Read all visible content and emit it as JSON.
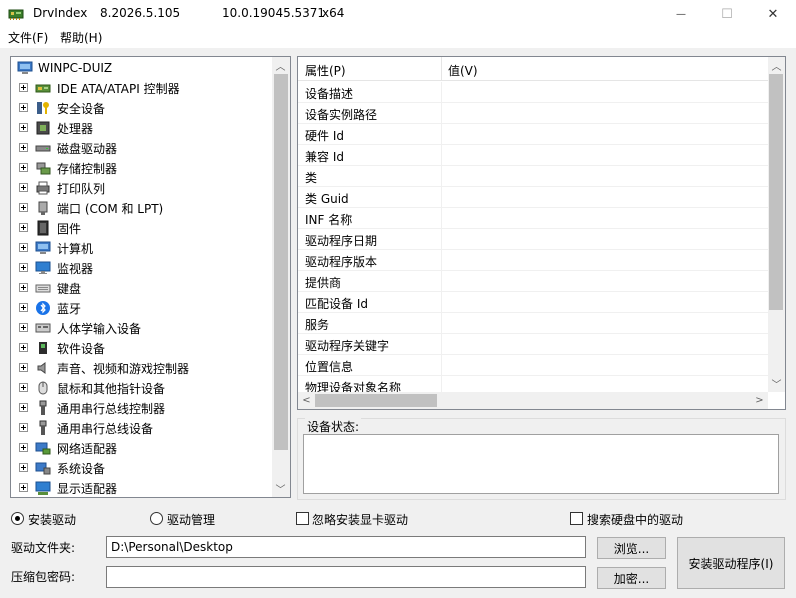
{
  "window": {
    "app_name": "DrvIndex",
    "version": "8.2026.5.105",
    "os_build": "10.0.19045.5371",
    "arch": "x64",
    "minimize_glyph": "—",
    "maximize_glyph": "☐",
    "close_glyph": "✕"
  },
  "menu": {
    "file": "文件(F)",
    "help": "帮助(H)"
  },
  "tree": {
    "root": {
      "label": "WINPC-DUIZ",
      "icon": "computer-icon"
    },
    "items": [
      {
        "label": "IDE ATA/ATAPI 控制器",
        "icon": "ide-controller-icon"
      },
      {
        "label": "安全设备",
        "icon": "security-key-icon"
      },
      {
        "label": "处理器",
        "icon": "cpu-icon"
      },
      {
        "label": "磁盘驱动器",
        "icon": "disk-drive-icon"
      },
      {
        "label": "存储控制器",
        "icon": "storage-controller-icon"
      },
      {
        "label": "打印队列",
        "icon": "printer-icon"
      },
      {
        "label": "端口 (COM 和 LPT)",
        "icon": "port-icon"
      },
      {
        "label": "固件",
        "icon": "firmware-icon"
      },
      {
        "label": "计算机",
        "icon": "computer-icon"
      },
      {
        "label": "监视器",
        "icon": "monitor-icon"
      },
      {
        "label": "键盘",
        "icon": "keyboard-icon"
      },
      {
        "label": "蓝牙",
        "icon": "bluetooth-icon"
      },
      {
        "label": "人体学输入设备",
        "icon": "hid-icon"
      },
      {
        "label": "软件设备",
        "icon": "software-device-icon"
      },
      {
        "label": "声音、视频和游戏控制器",
        "icon": "speaker-icon"
      },
      {
        "label": "鼠标和其他指针设备",
        "icon": "mouse-icon"
      },
      {
        "label": "通用串行总线控制器",
        "icon": "usb-icon"
      },
      {
        "label": "通用串行总线设备",
        "icon": "usb-icon"
      },
      {
        "label": "网络适配器",
        "icon": "network-adapter-icon"
      },
      {
        "label": "系统设备",
        "icon": "system-device-icon"
      },
      {
        "label": "显示适配器",
        "icon": "display-adapter-icon"
      }
    ]
  },
  "properties": {
    "col_property": "属性(P)",
    "col_value": "值(V)",
    "rows": [
      "设备描述",
      "设备实例路径",
      "硬件 Id",
      "兼容 Id",
      "类",
      "类 Guid",
      "INF 名称",
      "驱动程序日期",
      "驱动程序版本",
      "提供商",
      "匹配设备 Id",
      "服务",
      "驱动程序关键字",
      "位置信息",
      "物理设备对象名称"
    ]
  },
  "status": {
    "legend": "设备状态:",
    "text": ""
  },
  "options": {
    "install_driver": "安装驱动",
    "driver_manage": "驱动管理",
    "mode_selected": "install_driver",
    "ignore_display_driver": "忽略安装显卡驱动",
    "ignore_display_checked": false,
    "search_disk_drivers": "搜索硬盘中的驱动",
    "search_disk_checked": false
  },
  "inputs": {
    "driver_folder_label": "驱动文件夹:",
    "driver_folder_value": "D:\\Personal\\Desktop",
    "browse_button": "浏览...",
    "archive_password_label": "压缩包密码:",
    "archive_password_value": "",
    "encrypt_button": "加密...",
    "install_button": "安装驱动程序(I)"
  }
}
